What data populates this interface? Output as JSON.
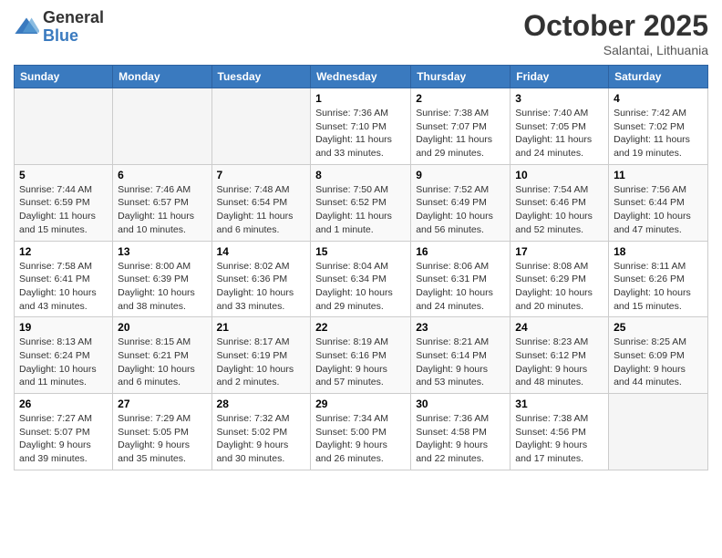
{
  "logo": {
    "general": "General",
    "blue": "Blue"
  },
  "title": "October 2025",
  "location": "Salantai, Lithuania",
  "days_of_week": [
    "Sunday",
    "Monday",
    "Tuesday",
    "Wednesday",
    "Thursday",
    "Friday",
    "Saturday"
  ],
  "weeks": [
    [
      {
        "day": "",
        "info": ""
      },
      {
        "day": "",
        "info": ""
      },
      {
        "day": "",
        "info": ""
      },
      {
        "day": "1",
        "info": "Sunrise: 7:36 AM\nSunset: 7:10 PM\nDaylight: 11 hours\nand 33 minutes."
      },
      {
        "day": "2",
        "info": "Sunrise: 7:38 AM\nSunset: 7:07 PM\nDaylight: 11 hours\nand 29 minutes."
      },
      {
        "day": "3",
        "info": "Sunrise: 7:40 AM\nSunset: 7:05 PM\nDaylight: 11 hours\nand 24 minutes."
      },
      {
        "day": "4",
        "info": "Sunrise: 7:42 AM\nSunset: 7:02 PM\nDaylight: 11 hours\nand 19 minutes."
      }
    ],
    [
      {
        "day": "5",
        "info": "Sunrise: 7:44 AM\nSunset: 6:59 PM\nDaylight: 11 hours\nand 15 minutes."
      },
      {
        "day": "6",
        "info": "Sunrise: 7:46 AM\nSunset: 6:57 PM\nDaylight: 11 hours\nand 10 minutes."
      },
      {
        "day": "7",
        "info": "Sunrise: 7:48 AM\nSunset: 6:54 PM\nDaylight: 11 hours\nand 6 minutes."
      },
      {
        "day": "8",
        "info": "Sunrise: 7:50 AM\nSunset: 6:52 PM\nDaylight: 11 hours\nand 1 minute."
      },
      {
        "day": "9",
        "info": "Sunrise: 7:52 AM\nSunset: 6:49 PM\nDaylight: 10 hours\nand 56 minutes."
      },
      {
        "day": "10",
        "info": "Sunrise: 7:54 AM\nSunset: 6:46 PM\nDaylight: 10 hours\nand 52 minutes."
      },
      {
        "day": "11",
        "info": "Sunrise: 7:56 AM\nSunset: 6:44 PM\nDaylight: 10 hours\nand 47 minutes."
      }
    ],
    [
      {
        "day": "12",
        "info": "Sunrise: 7:58 AM\nSunset: 6:41 PM\nDaylight: 10 hours\nand 43 minutes."
      },
      {
        "day": "13",
        "info": "Sunrise: 8:00 AM\nSunset: 6:39 PM\nDaylight: 10 hours\nand 38 minutes."
      },
      {
        "day": "14",
        "info": "Sunrise: 8:02 AM\nSunset: 6:36 PM\nDaylight: 10 hours\nand 33 minutes."
      },
      {
        "day": "15",
        "info": "Sunrise: 8:04 AM\nSunset: 6:34 PM\nDaylight: 10 hours\nand 29 minutes."
      },
      {
        "day": "16",
        "info": "Sunrise: 8:06 AM\nSunset: 6:31 PM\nDaylight: 10 hours\nand 24 minutes."
      },
      {
        "day": "17",
        "info": "Sunrise: 8:08 AM\nSunset: 6:29 PM\nDaylight: 10 hours\nand 20 minutes."
      },
      {
        "day": "18",
        "info": "Sunrise: 8:11 AM\nSunset: 6:26 PM\nDaylight: 10 hours\nand 15 minutes."
      }
    ],
    [
      {
        "day": "19",
        "info": "Sunrise: 8:13 AM\nSunset: 6:24 PM\nDaylight: 10 hours\nand 11 minutes."
      },
      {
        "day": "20",
        "info": "Sunrise: 8:15 AM\nSunset: 6:21 PM\nDaylight: 10 hours\nand 6 minutes."
      },
      {
        "day": "21",
        "info": "Sunrise: 8:17 AM\nSunset: 6:19 PM\nDaylight: 10 hours\nand 2 minutes."
      },
      {
        "day": "22",
        "info": "Sunrise: 8:19 AM\nSunset: 6:16 PM\nDaylight: 9 hours\nand 57 minutes."
      },
      {
        "day": "23",
        "info": "Sunrise: 8:21 AM\nSunset: 6:14 PM\nDaylight: 9 hours\nand 53 minutes."
      },
      {
        "day": "24",
        "info": "Sunrise: 8:23 AM\nSunset: 6:12 PM\nDaylight: 9 hours\nand 48 minutes."
      },
      {
        "day": "25",
        "info": "Sunrise: 8:25 AM\nSunset: 6:09 PM\nDaylight: 9 hours\nand 44 minutes."
      }
    ],
    [
      {
        "day": "26",
        "info": "Sunrise: 7:27 AM\nSunset: 5:07 PM\nDaylight: 9 hours\nand 39 minutes."
      },
      {
        "day": "27",
        "info": "Sunrise: 7:29 AM\nSunset: 5:05 PM\nDaylight: 9 hours\nand 35 minutes."
      },
      {
        "day": "28",
        "info": "Sunrise: 7:32 AM\nSunset: 5:02 PM\nDaylight: 9 hours\nand 30 minutes."
      },
      {
        "day": "29",
        "info": "Sunrise: 7:34 AM\nSunset: 5:00 PM\nDaylight: 9 hours\nand 26 minutes."
      },
      {
        "day": "30",
        "info": "Sunrise: 7:36 AM\nSunset: 4:58 PM\nDaylight: 9 hours\nand 22 minutes."
      },
      {
        "day": "31",
        "info": "Sunrise: 7:38 AM\nSunset: 4:56 PM\nDaylight: 9 hours\nand 17 minutes."
      },
      {
        "day": "",
        "info": ""
      }
    ]
  ]
}
